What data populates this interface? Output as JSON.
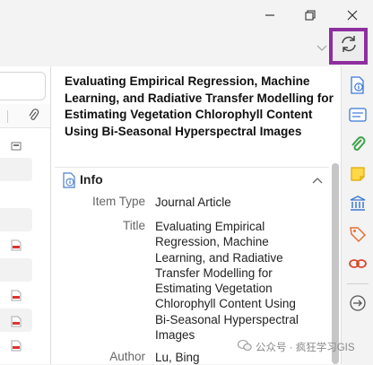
{
  "window": {
    "minimize_icon": "minimize-icon",
    "restore_icon": "restore-icon",
    "close_icon": "close-icon"
  },
  "toolbar": {
    "sync_icon": "sync-icon",
    "highlight_color": "#8e2f9e"
  },
  "item": {
    "title": "Evaluating Empirical Regression, Machine Learning, and Radiative Transfer Modelling for Estimating Vegetation Chlorophyll Content Using Bi-Seasonal Hyperspectral Images"
  },
  "info_section": {
    "title": "Info",
    "fields": {
      "item_type_label": "Item Type",
      "item_type_value": "Journal Article",
      "title_label": "Title",
      "title_value": "Evaluating Empirical Regression, Machine Learning, and Radiative Transfer Modelling for Estimating Vegetation Chlorophyll Content Using Bi-Seasonal Hyperspectral Images",
      "author_label": "Author",
      "author_value": "Lu, Bing"
    }
  },
  "sidenav": {
    "items": [
      "info-icon",
      "abstract-icon",
      "attachments-icon",
      "notes-icon",
      "libraries-collections-icon",
      "tags-icon",
      "related-icon",
      "locate-icon"
    ]
  },
  "watermark": {
    "text": "公众号 · 疯狂学习GIS"
  }
}
